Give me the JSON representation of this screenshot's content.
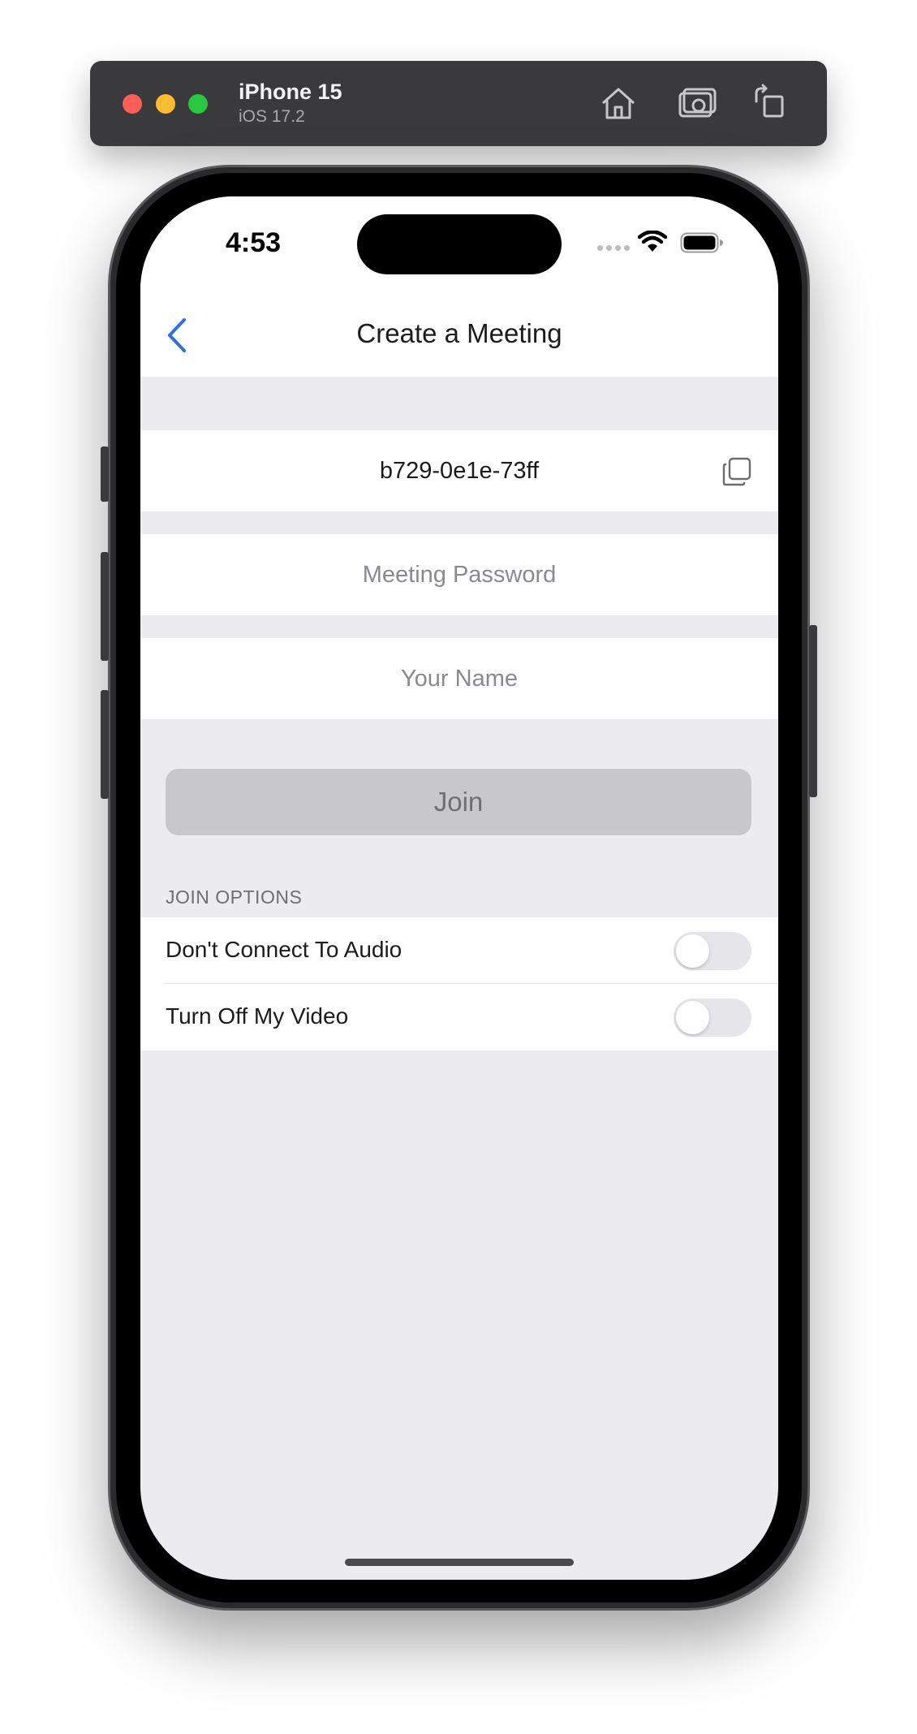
{
  "simulator": {
    "device_name": "iPhone 15",
    "os_version": "iOS 17.2",
    "icons": [
      "home-icon",
      "screenshot-icon",
      "rotate-icon"
    ]
  },
  "status_bar": {
    "time": "4:53"
  },
  "nav": {
    "title": "Create a Meeting",
    "back_icon": "chevron-left-icon"
  },
  "form": {
    "meeting_id": "b729-0e1e-73ff",
    "password_placeholder": "Meeting Password",
    "name_placeholder": "Your Name",
    "join_label": "Join"
  },
  "join_options": {
    "header": "JOIN OPTIONS",
    "items": [
      {
        "label": "Don't Connect To Audio",
        "enabled": false
      },
      {
        "label": "Turn Off My Video",
        "enabled": false
      }
    ]
  },
  "colors": {
    "accent": "#2f6fe0",
    "background": "#ececee",
    "button_disabled": "#c8c8cc"
  }
}
